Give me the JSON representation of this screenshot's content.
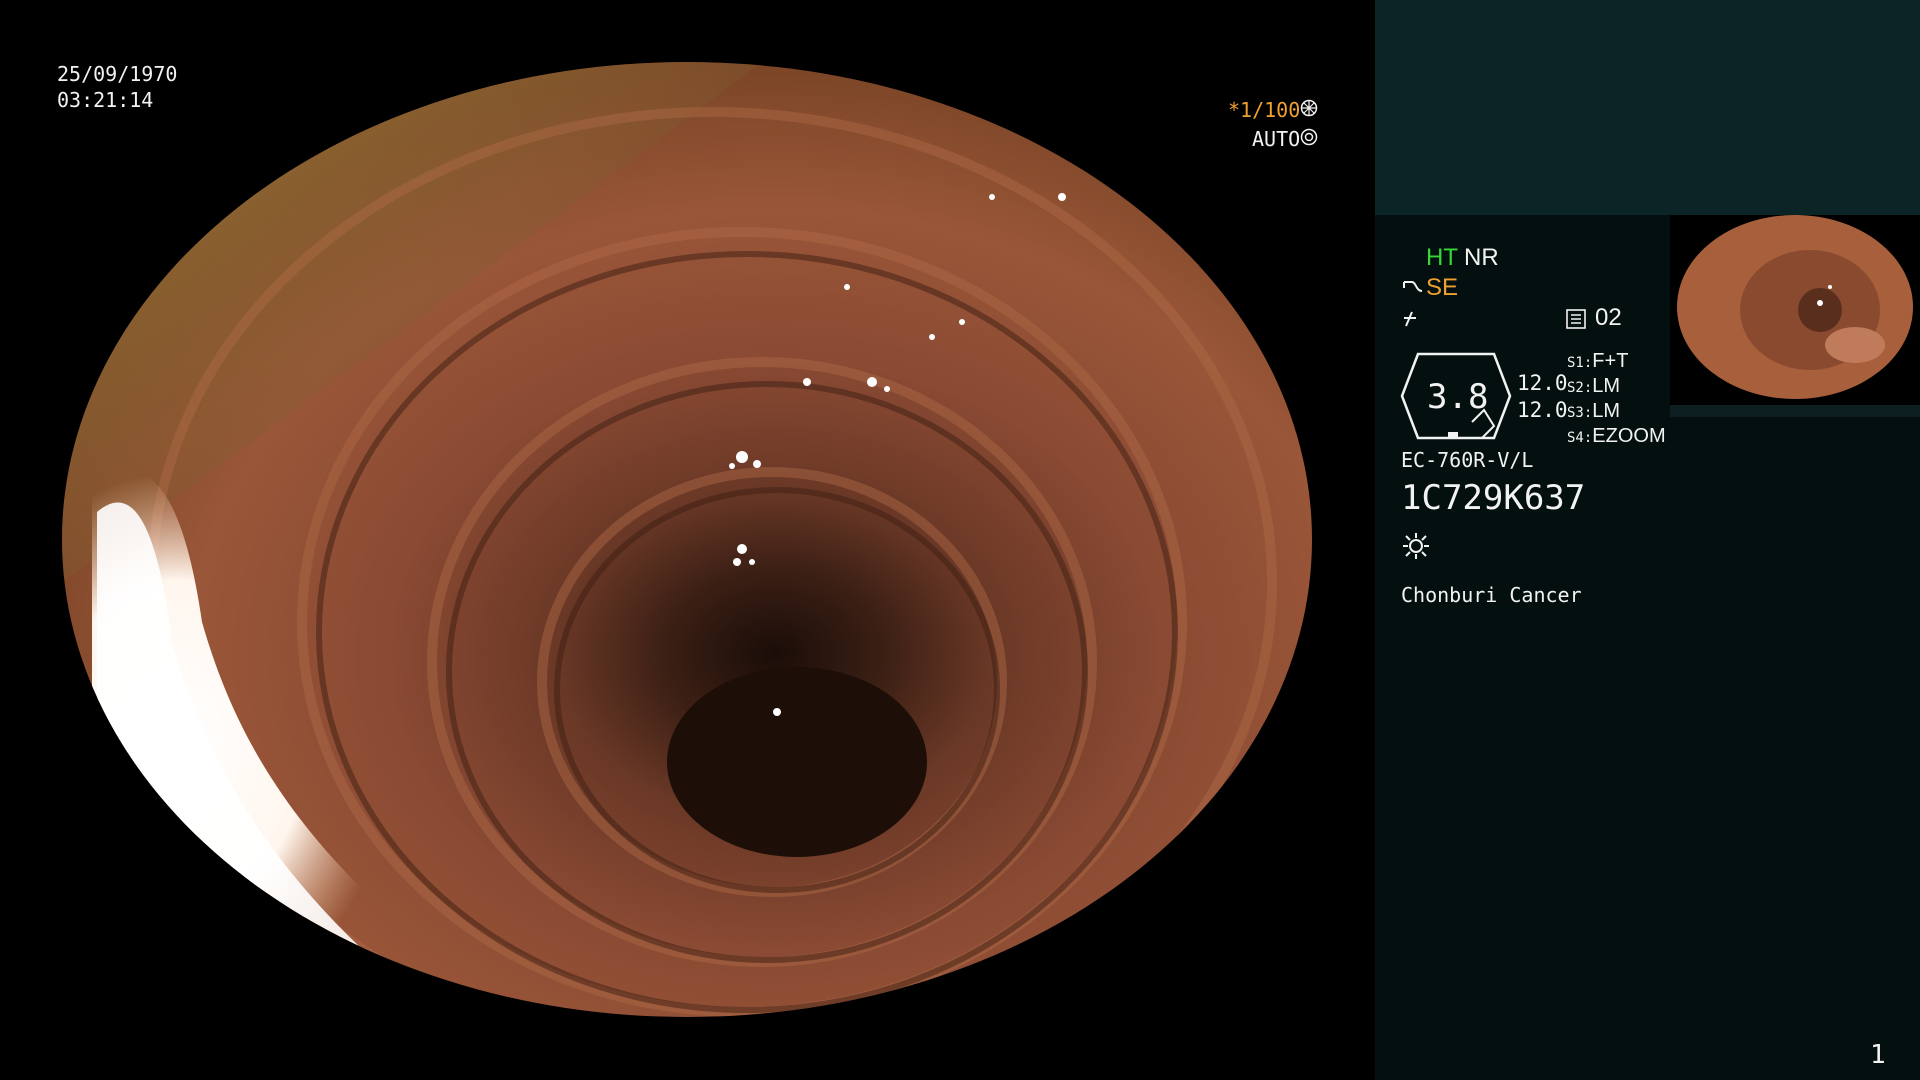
{
  "overlay": {
    "date": "25/09/1970",
    "time": "03:21:14",
    "shutter": "*1/100",
    "iris_mode": "AUTO"
  },
  "panel": {
    "ht": "HT",
    "nr": "NR",
    "se": "SE",
    "memory_slot": "02",
    "gauge_value": "3.8",
    "value_top": "12.0",
    "value_bottom": "12.0",
    "switches": [
      {
        "key": "S1:",
        "value": "F+T"
      },
      {
        "key": "S2:",
        "value": "LM"
      },
      {
        "key": "S3:",
        "value": "LM"
      },
      {
        "key": "S4:",
        "value": "EZOOM"
      }
    ],
    "scope_model": "EC-760R-V/L",
    "scope_serial": "1C729K637",
    "hospital": "Chonburi Cancer",
    "page_number": "1"
  },
  "icons": {
    "shutter_icon": "aperture-icon",
    "iris_icon": "iris-icon",
    "scope_icon": "scope-tip-icon",
    "water_icon": "water-jet-icon",
    "memory_icon": "memory-card-icon",
    "light_icon": "light-sun-icon"
  },
  "colors": {
    "accent_orange": "#f0a030",
    "accent_green": "#36d836",
    "panel_bg": "#03100f",
    "panel_top": "#0b2526"
  }
}
